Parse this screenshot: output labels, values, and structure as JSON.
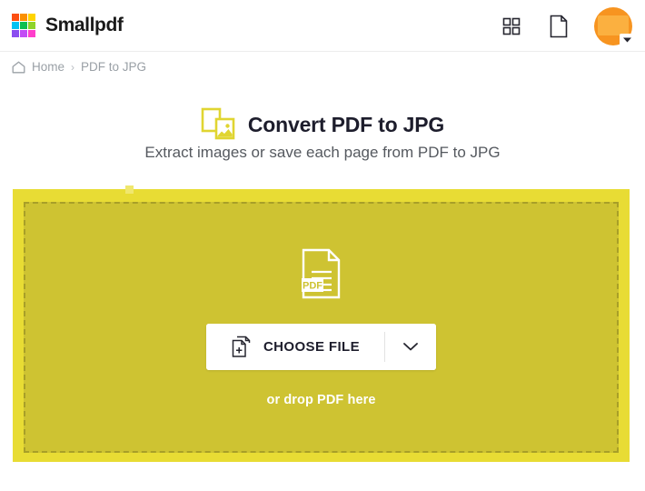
{
  "header": {
    "brand_name": "Smallpdf",
    "logo_colors": [
      "#fc4f12",
      "#fb9000",
      "#ffd400",
      "#00c2f3",
      "#0dbf4f",
      "#8ed42a",
      "#8b4df0",
      "#c24cf5",
      "#ff3ecb"
    ],
    "apps_icon": "grid-icon",
    "documents_icon": "document-icon",
    "avatar_icon": "avatar",
    "avatar_color": "#f79420",
    "avatar_caret_icon": "chevron-down-icon"
  },
  "breadcrumb": {
    "home_icon": "home-icon",
    "home_label": "Home",
    "separator": "›",
    "current_label": "PDF to JPG"
  },
  "page": {
    "tool_icon": "image-convert-icon",
    "title": "Convert PDF to JPG",
    "subtitle": "Extract images or save each page from PDF to JPG"
  },
  "dropzone": {
    "illustration_icon": "pdf-file-icon",
    "illustration_label": "PDF",
    "choose_file_icon": "add-document-icon",
    "choose_file_label": "CHOOSE FILE",
    "caret_icon": "chevron-down-icon",
    "drop_hint": "or drop PDF here",
    "outer_color": "#e8dc34",
    "inner_color": "#cec332",
    "border_color": "#a89f28"
  }
}
